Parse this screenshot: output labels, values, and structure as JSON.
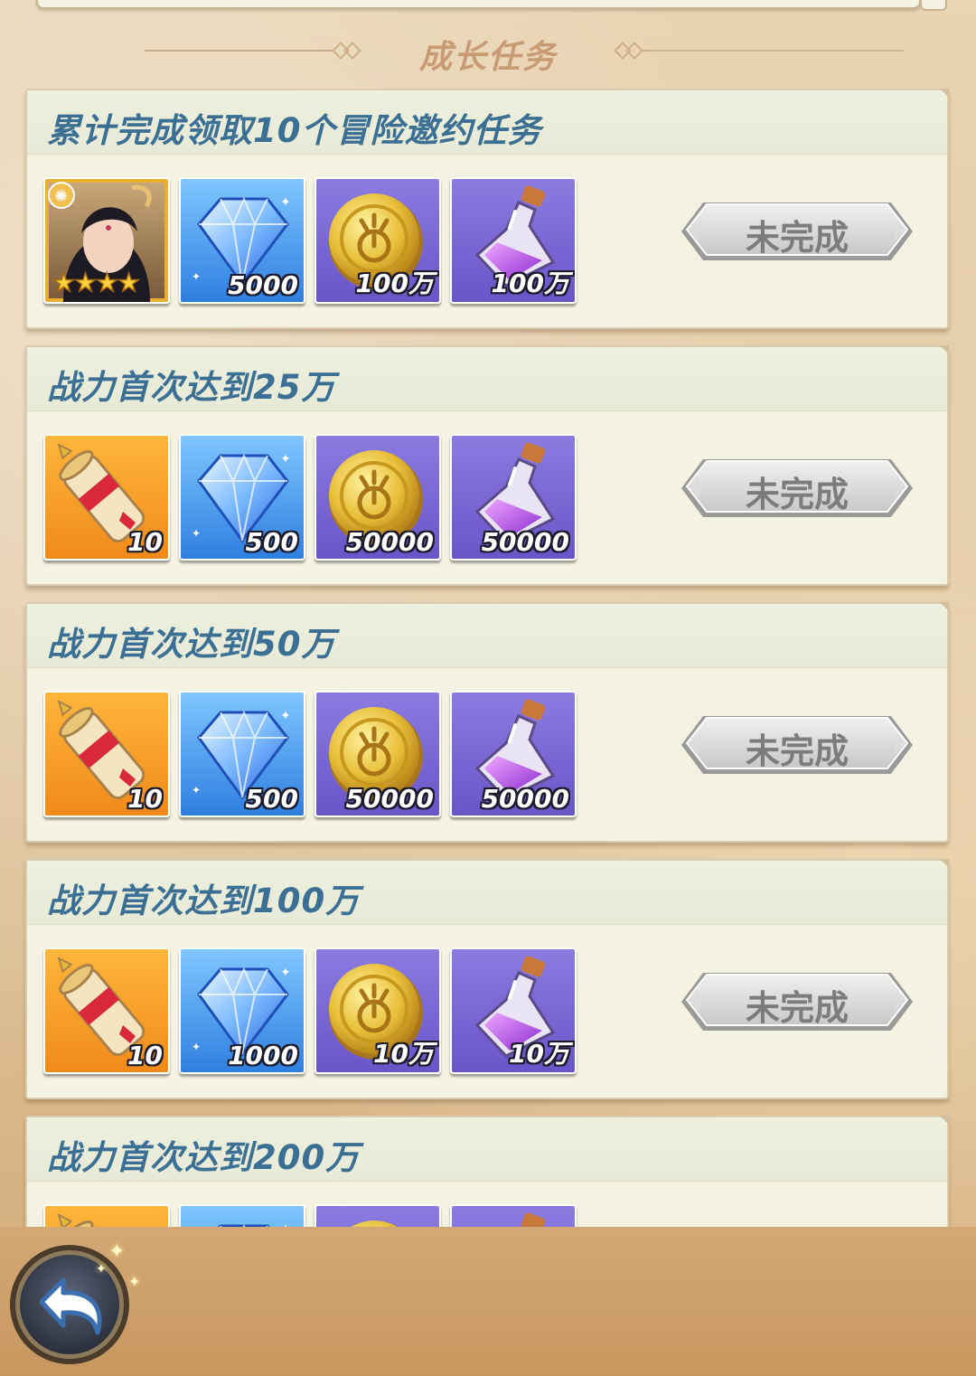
{
  "section": {
    "title": "成长任务"
  },
  "tasks": [
    {
      "title": "累计完成领取10个冒险邀约任务",
      "rewards": [
        {
          "icon": "hero-portrait-icon",
          "count": "",
          "stars": 4
        },
        {
          "icon": "diamond-icon",
          "count": "5000"
        },
        {
          "icon": "gold-coin-icon",
          "count": "100万"
        },
        {
          "icon": "purple-potion-icon",
          "count": "100万"
        }
      ],
      "status": "未完成"
    },
    {
      "title": "战力首次达到25万",
      "rewards": [
        {
          "icon": "scroll-icon",
          "count": "10"
        },
        {
          "icon": "diamond-icon",
          "count": "500"
        },
        {
          "icon": "gold-coin-icon",
          "count": "50000"
        },
        {
          "icon": "purple-potion-icon",
          "count": "50000"
        }
      ],
      "status": "未完成"
    },
    {
      "title": "战力首次达到50万",
      "rewards": [
        {
          "icon": "scroll-icon",
          "count": "10"
        },
        {
          "icon": "diamond-icon",
          "count": "500"
        },
        {
          "icon": "gold-coin-icon",
          "count": "50000"
        },
        {
          "icon": "purple-potion-icon",
          "count": "50000"
        }
      ],
      "status": "未完成"
    },
    {
      "title": "战力首次达到100万",
      "rewards": [
        {
          "icon": "scroll-icon",
          "count": "10"
        },
        {
          "icon": "diamond-icon",
          "count": "1000"
        },
        {
          "icon": "gold-coin-icon",
          "count": "10万"
        },
        {
          "icon": "purple-potion-icon",
          "count": "10万"
        }
      ],
      "status": "未完成"
    },
    {
      "title": "战力首次达到200万",
      "rewards": [
        {
          "icon": "scroll-icon",
          "count": ""
        },
        {
          "icon": "diamond-icon",
          "count": ""
        },
        {
          "icon": "gold-coin-icon",
          "count": ""
        },
        {
          "icon": "purple-potion-icon",
          "count": ""
        }
      ],
      "status": ""
    }
  ],
  "footer": {
    "back_icon": "back-arrow-icon"
  },
  "colors": {
    "title_text": "#3b6f93",
    "card_bg": "#f4f2e1",
    "button_text": "#7c7c7c",
    "header_text": "#c99b74"
  }
}
